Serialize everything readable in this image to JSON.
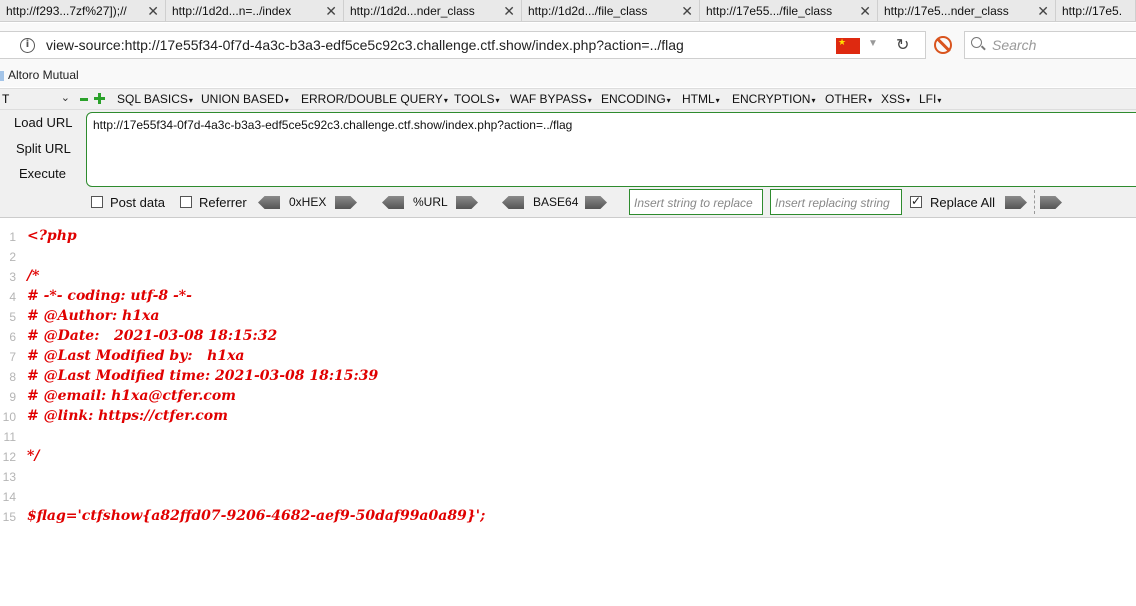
{
  "tabs": [
    {
      "label": "http://f293...7zf%27]);//",
      "width": 166
    },
    {
      "label": "http://1d2d...n=../index",
      "width": 178
    },
    {
      "label": "http://1d2d...nder_class",
      "width": 178
    },
    {
      "label": "http://1d2d.../file_class",
      "width": 178
    },
    {
      "label": "http://17e55.../file_class",
      "width": 178
    },
    {
      "label": "http://17e5...nder_class",
      "width": 178
    },
    {
      "label": "http://17e5.",
      "width": 80
    }
  ],
  "address_bar": {
    "url": "view-source:http://17e55f34-0f7d-4a3c-b3a3-edf5ce5c92c3.challenge.ctf.show/index.php?action=../flag",
    "search_placeholder": "Search"
  },
  "bookmarks": {
    "label": "Altoro Mutual"
  },
  "hackbar": {
    "select_value": "T",
    "menu": [
      "SQL BASICS",
      "UNION BASED",
      "ERROR/DOUBLE QUERY",
      "TOOLS",
      "WAF BYPASS",
      "ENCODING",
      "HTML",
      "ENCRYPTION",
      "OTHER",
      "XSS",
      "LFI"
    ],
    "load_url": "Load URL",
    "split_url": "Split URL",
    "execute": "Execute",
    "url_value": "http://17e55f34-0f7d-4a3c-b3a3-edf5ce5c92c3.challenge.ctf.show/index.php?action=../flag",
    "post_data": "Post data",
    "referrer": "Referrer",
    "hex": "0xHEX",
    "url_enc": "%URL",
    "base64": "BASE64",
    "replace_placeholder": "Insert string to replace",
    "replacing_placeholder": "Insert replacing string",
    "replace_all": "Replace All"
  },
  "source_lines": [
    {
      "n": "1",
      "code": "<?php"
    },
    {
      "n": "2",
      "code": ""
    },
    {
      "n": "3",
      "code": "/*"
    },
    {
      "n": "4",
      "code": "# -*- coding: utf-8 -*-"
    },
    {
      "n": "5",
      "code": "# @Author: h1xa"
    },
    {
      "n": "6",
      "code": "# @Date:   2021-03-08 18:15:32"
    },
    {
      "n": "7",
      "code": "# @Last Modified by:   h1xa"
    },
    {
      "n": "8",
      "code": "# @Last Modified time: 2021-03-08 18:15:39"
    },
    {
      "n": "9",
      "code": "# @email: h1xa@ctfer.com"
    },
    {
      "n": "10",
      "code": "# @link: https://ctfer.com"
    },
    {
      "n": "11",
      "code": ""
    },
    {
      "n": "12",
      "code": "*/"
    },
    {
      "n": "13",
      "code": ""
    },
    {
      "n": "14",
      "code": ""
    },
    {
      "n": "15",
      "code": "$flag='ctfshow{a82ffd07-9206-4682-aef9-50daf99a0a89}';"
    }
  ]
}
